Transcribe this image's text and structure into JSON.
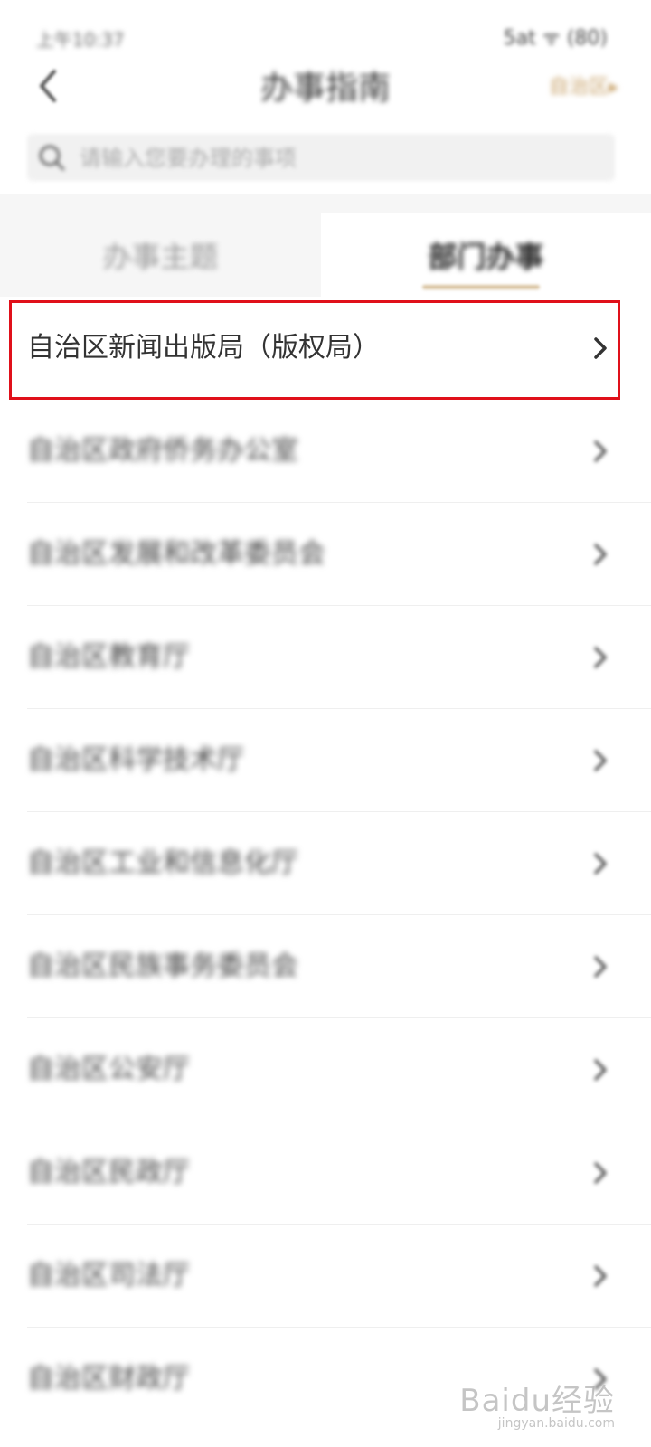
{
  "status_bar": {
    "time": "上午10:37",
    "icons": "5at ᯤ (80)"
  },
  "nav": {
    "title": "办事指南",
    "location": "自治区"
  },
  "search": {
    "placeholder": "请输入您要办理的事项"
  },
  "tabs": [
    {
      "label": "办事主题",
      "active": false
    },
    {
      "label": "部门办事",
      "active": true
    }
  ],
  "colors": {
    "accent": "#d9c3a0",
    "location": "#c8a26a",
    "highlight": "#e0101a"
  },
  "list": {
    "items": [
      {
        "label": "自治区新闻出版局（版权局）",
        "highlighted": true
      },
      {
        "label": "自治区政府侨务办公室",
        "highlighted": false
      },
      {
        "label": "自治区发展和改革委员会",
        "highlighted": false
      },
      {
        "label": "自治区教育厅",
        "highlighted": false
      },
      {
        "label": "自治区科学技术厅",
        "highlighted": false
      },
      {
        "label": "自治区工业和信息化厅",
        "highlighted": false
      },
      {
        "label": "自治区民族事务委员会",
        "highlighted": false
      },
      {
        "label": "自治区公安厅",
        "highlighted": false
      },
      {
        "label": "自治区民政厅",
        "highlighted": false
      },
      {
        "label": "自治区司法厅",
        "highlighted": false
      },
      {
        "label": "自治区财政厅",
        "highlighted": false
      }
    ]
  },
  "watermark": {
    "logo": "Baidu经验",
    "url": "jingyan.baidu.com"
  }
}
